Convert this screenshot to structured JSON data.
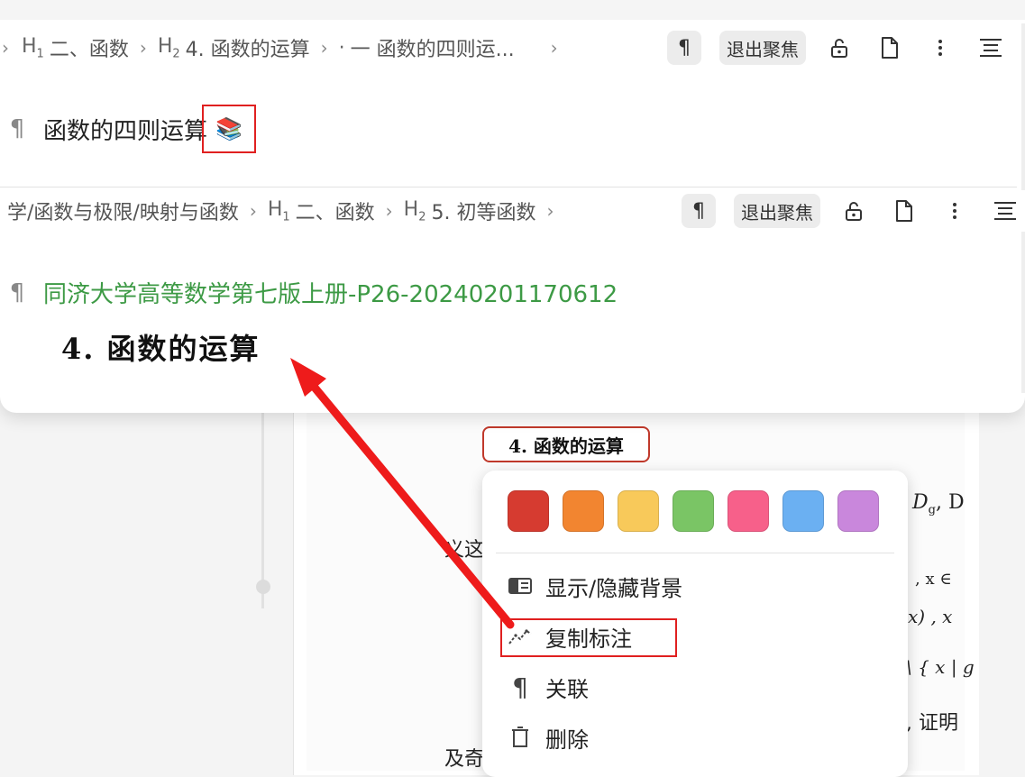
{
  "background": {
    "pdf_heading": "4. 函数的运算",
    "fragments": {
      "dg": "D",
      "dg_sub": "g",
      "dg_tail": ", D",
      "yi": "义这",
      "x_in": ", x ∈",
      "x_paren": "x) , x",
      "set": "\\ { x | g",
      "proof": ", 证明",
      "ji": "及奇"
    }
  },
  "panel": {
    "block1": {
      "breadcrumb": [
        {
          "tag": "H",
          "level": "1",
          "label": "二、函数"
        },
        {
          "tag": "H",
          "level": "2",
          "label": "4. 函数的运算"
        },
        {
          "tag": "·",
          "level": "",
          "label": "一 函数的四则运..."
        }
      ],
      "exit_focus": "退出聚焦",
      "pilcrow": "¶",
      "title": "函数的四则运算",
      "emoji": "📚"
    },
    "block2": {
      "path_prefix": "学/函数与极限/映射与函数",
      "breadcrumb": [
        {
          "tag": "H",
          "level": "1",
          "label": "二、函数"
        },
        {
          "tag": "H",
          "level": "2",
          "label": "5. 初等函数"
        }
      ],
      "exit_focus": "退出聚焦",
      "pilcrow": "¶",
      "link_text": "同济大学高等数学第七版上册-P26-20240201170612",
      "image_heading": "4. 函数的运算"
    }
  },
  "context_menu": {
    "swatches": [
      {
        "name": "red",
        "color": "#d63b30"
      },
      {
        "name": "orange",
        "color": "#f28530"
      },
      {
        "name": "yellow",
        "color": "#f8c95a"
      },
      {
        "name": "green",
        "color": "#7ac565"
      },
      {
        "name": "pink",
        "color": "#f7608a"
      },
      {
        "name": "blue",
        "color": "#6bb0f2"
      },
      {
        "name": "purple",
        "color": "#c987dc"
      }
    ],
    "items": [
      {
        "label": "显示/隐藏背景",
        "icon": "background-toggle-icon"
      },
      {
        "label": "复制标注",
        "icon": "annotation-copy-icon"
      },
      {
        "label": "关联",
        "icon": "pilcrow-icon"
      },
      {
        "label": "删除",
        "icon": "trash-icon"
      }
    ]
  },
  "annotation_color": "#e02020"
}
